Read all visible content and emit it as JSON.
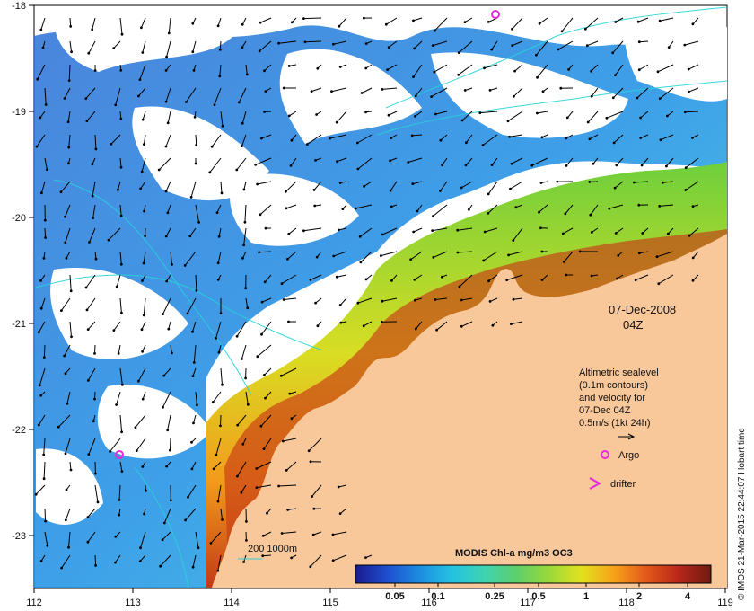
{
  "map": {
    "x_ticks": [
      "112",
      "113",
      "114",
      "115",
      "116",
      "117",
      "118",
      "119"
    ],
    "y_ticks": [
      "-18",
      "-19",
      "-20",
      "-21",
      "-22",
      "-23"
    ],
    "land_color": "#f8c79a",
    "contour_color": "#27d3d9",
    "marker_color": "#e62ad9"
  },
  "annotations": {
    "date": "07-Dec-2008",
    "time": "04Z",
    "legend_line1": "Altimetric sealevel",
    "legend_line2": "(0.1m contours)",
    "legend_line3": "and velocity for",
    "legend_line4": "07-Dec 04Z",
    "legend_line5": "0.5m/s (1kt 24h)",
    "argo_label": "Argo",
    "drifter_label": "drifter",
    "depth_label": "200  1000m",
    "credit": "© IMOS 21-Mar-2015 22:44:07 Hobart time"
  },
  "colorbar": {
    "title": "MODIS Chl-a mg/m3 OC3",
    "ticks": [
      "0.05",
      "0.1",
      "0.25",
      "0.5",
      "1",
      "2",
      "4"
    ],
    "ramp": [
      "#1a1a8f",
      "#1f4fcf",
      "#1c8ee0",
      "#25c3e0",
      "#3fd3b0",
      "#5fcf6a",
      "#9ad93a",
      "#e2e21f",
      "#f7a21a",
      "#e2581a",
      "#b8271a",
      "#6e1a12"
    ]
  }
}
